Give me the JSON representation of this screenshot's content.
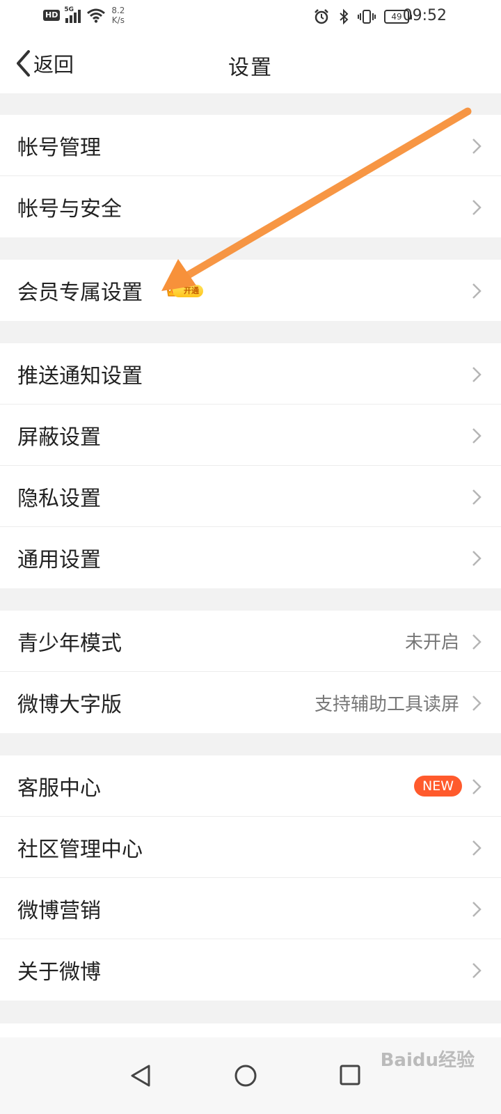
{
  "status_bar": {
    "hd_label": "HD",
    "network_label": "5G",
    "speed_value": "8.2",
    "speed_unit": "K/s",
    "battery": "49",
    "time": "09:52"
  },
  "nav": {
    "back_label": "返回",
    "title": "设置"
  },
  "groups": [
    {
      "items": [
        {
          "label": "帐号管理"
        },
        {
          "label": "帐号与安全"
        }
      ]
    },
    {
      "items": [
        {
          "label": "会员专属设置",
          "badge": "开通"
        }
      ]
    },
    {
      "items": [
        {
          "label": "推送通知设置"
        },
        {
          "label": "屏蔽设置"
        },
        {
          "label": "隐私设置"
        },
        {
          "label": "通用设置"
        }
      ]
    },
    {
      "items": [
        {
          "label": "青少年模式",
          "value": "未开启"
        },
        {
          "label": "微博大字版",
          "value": "支持辅助工具读屏"
        }
      ]
    },
    {
      "items": [
        {
          "label": "客服中心",
          "badge": "NEW"
        },
        {
          "label": "社区管理中心"
        },
        {
          "label": "微博营销"
        },
        {
          "label": "关于微博"
        }
      ]
    }
  ],
  "colors": {
    "annotation_arrow": "#f7913a",
    "new_badge": "#ff5a2c",
    "vip_badge": "#ffd233"
  },
  "watermark": "Baidu经验"
}
